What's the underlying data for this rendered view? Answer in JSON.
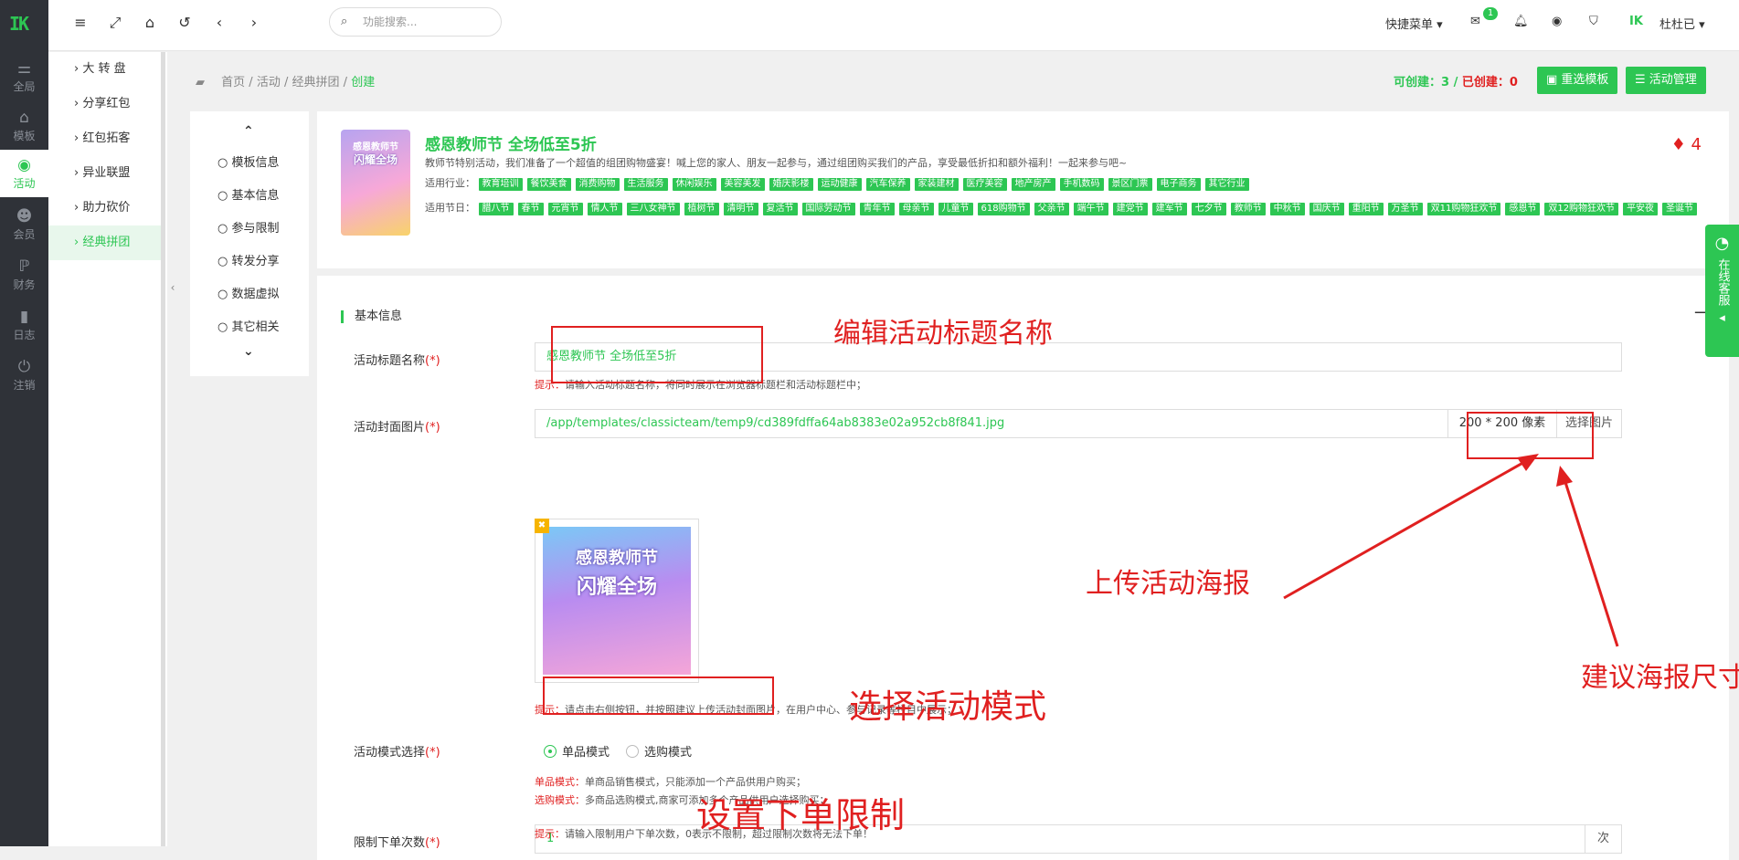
{
  "leftbar": {
    "logo": "IK",
    "items": [
      {
        "icon": "sliders-icon",
        "label": "全局"
      },
      {
        "icon": "sitemap-icon",
        "label": "模板"
      },
      {
        "icon": "broadcast-icon",
        "label": "活动"
      },
      {
        "icon": "users-icon",
        "label": "会员"
      },
      {
        "icon": "paypal-icon",
        "label": "财务"
      },
      {
        "icon": "bookmark-icon",
        "label": "日志"
      },
      {
        "icon": "power-icon",
        "label": "注销"
      }
    ]
  },
  "sidebar": {
    "items": [
      "大 转 盘",
      "分享红包",
      "红包拓客",
      "异业联盟",
      "助力砍价",
      "经典拼团"
    ],
    "active": "经典拼团"
  },
  "topbar": {
    "search_placeholder": "功能搜索...",
    "quick_menu": "快捷菜单",
    "message_count": "1",
    "user_name": "杜杜已"
  },
  "breadcrumb": {
    "home": "首页",
    "level1": "活动",
    "level2": "经典拼团",
    "current": "创建",
    "sep": "/"
  },
  "counts": {
    "can_create_label": "可创建：",
    "can_create": "3",
    "sep": " / ",
    "created_label": "已创建：",
    "created": "0"
  },
  "buttons": {
    "reselect_template": "重选模板",
    "activity_manage": "活动管理"
  },
  "side_nav": [
    "模板信息",
    "基本信息",
    "参与限制",
    "转发分享",
    "数据虚拟",
    "其它相关"
  ],
  "hero": {
    "image_line1": "感恩教师节",
    "image_line2": "闪耀全场",
    "title": "感恩教师节 全场低至5折",
    "desc": "教师节特别活动，我们准备了一个超值的组团购物盛宴！喊上您的家人、朋友一起参与，通过组团购买我们的产品，享受最低折扣和额外福利！一起来参与吧~",
    "industry_label": "适用行业：",
    "industries": [
      "教育培训",
      "餐饮美食",
      "消费购物",
      "生活服务",
      "休闲娱乐",
      "美容美发",
      "婚庆影楼",
      "运动健康",
      "汽车保养",
      "家装建材",
      "医疗美容",
      "地产房产",
      "手机数码",
      "景区门票",
      "电子商务",
      "其它行业"
    ],
    "festival_label": "适用节日：",
    "festivals": [
      "腊八节",
      "春节",
      "元宵节",
      "情人节",
      "三八女神节",
      "植树节",
      "清明节",
      "复活节",
      "国际劳动节",
      "青年节",
      "母亲节",
      "儿童节",
      "618购物节",
      "父亲节",
      "端午节",
      "建党节",
      "建军节",
      "七夕节",
      "教师节",
      "中秋节",
      "国庆节",
      "重阳节",
      "万圣节",
      "双11购物狂欢节",
      "感恩节",
      "双12购物狂欢节",
      "平安夜",
      "圣诞节"
    ],
    "count": "4"
  },
  "form": {
    "section_title": "基本信息",
    "title_label": "活动标题名称",
    "title_value": "感恩教师节 全场低至5折",
    "title_hint_label": "提示：",
    "title_hint": "请输入活动标题名称，将同时展示在浏览器标题栏和活动标题栏中；",
    "cover_label": "活动封面图片",
    "cover_value": "/app/templates/classicteam/temp9/cd389fdffa64ab8383e02a952cb8f841.jpg",
    "cover_size": "200 * 200 像素",
    "cover_btn": "选择图片",
    "cover_hint_label": "提示：",
    "cover_hint": "请点击右侧按钮，并按照建议上传活动封面图片，在用户中心、参与记录等栏目中展示；",
    "preview_line1": "感恩教师节",
    "preview_line2": "闪耀全场",
    "mode_label": "活动模式选择",
    "mode_single": "单品模式",
    "mode_multi": "选购模式",
    "mode_hint1_label": "单品模式：",
    "mode_hint1": "单商品销售模式，只能添加一个产品供用户购买；",
    "mode_hint2_label": "选购模式：",
    "mode_hint2": "多商品选购模式,商家可添加多个产品供用户选择购买；",
    "limit_label": "限制下单次数",
    "limit_value": "1",
    "limit_unit": "次",
    "limit_hint_label": "提示：",
    "limit_hint": "请输入限制用户下单次数，0表示不限制，超过限制次数将无法下单！",
    "required": "(*)"
  },
  "annotations": {
    "edit_title": "编辑活动标题名称",
    "upload_poster": "上传活动海报",
    "suggest_size": "建议海报尺寸",
    "choose_mode": "选择活动模式",
    "set_limit": "设置下单限制"
  },
  "float_service": "在线客服"
}
